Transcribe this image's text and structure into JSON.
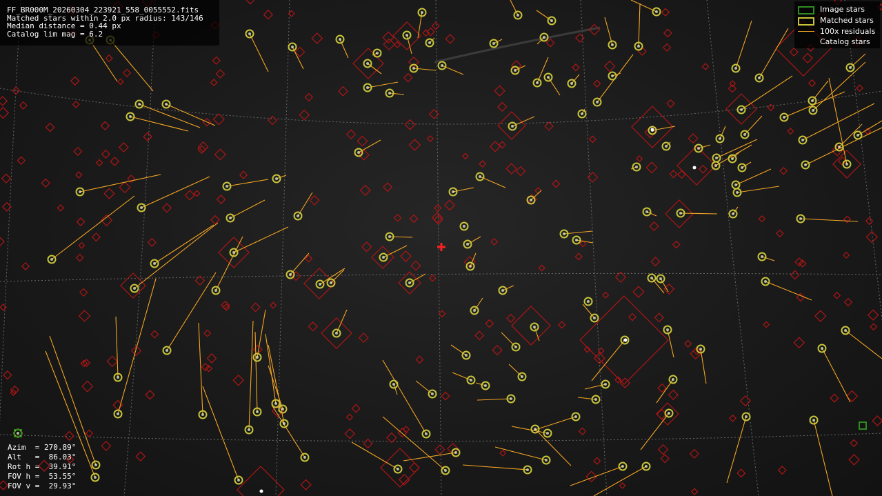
{
  "info": {
    "filename": "FF_BR000M_20260304_223921_558_0055552.fits",
    "matched": "Matched stars within 2.0 px radius: 143/146",
    "median": "Median distance = 0.44 px",
    "catalog": "Catalog lim mag = 6.2"
  },
  "legend": {
    "image_stars": "Image stars",
    "matched_stars": "Matched stars",
    "residuals": "100x residuals",
    "catalog_stars": "Catalog stars"
  },
  "pointing": {
    "azim": "Azim  = 270.89°",
    "alt": "Alt   =  86.03°",
    "rot": "Rot h =  39.91°",
    "fov_h": "FOV h =  53.55°",
    "fov_v": "FOV v =  29.93°"
  },
  "colors": {
    "image_star": "#2e8b1f",
    "matched_star": "#c8c43a",
    "residual": "#f5a623",
    "catalog": "#b01515",
    "center_mark": "#ff2020",
    "grid": "#6a6a6a"
  }
}
